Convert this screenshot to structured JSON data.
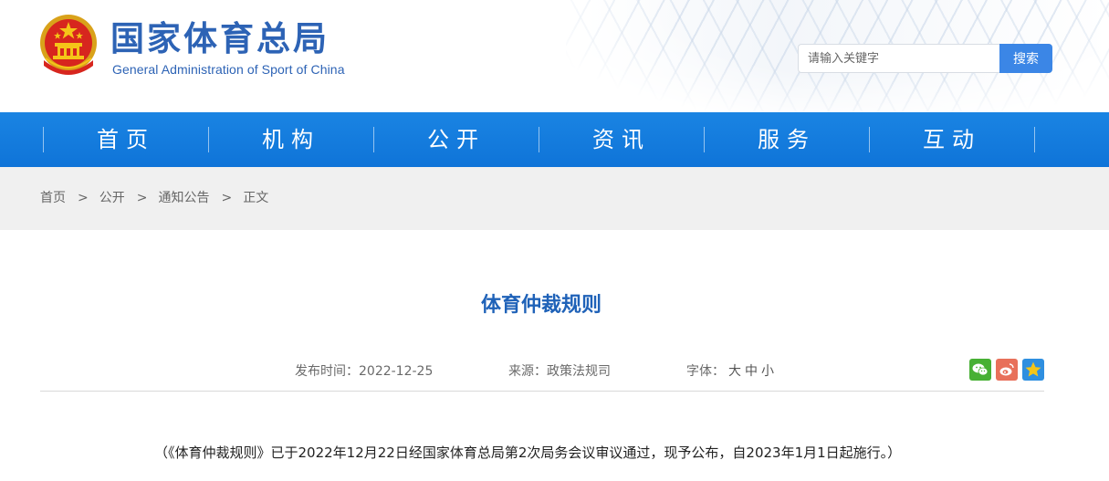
{
  "header": {
    "title_cn": "国家体育总局",
    "title_en": "General Administration of Sport of China",
    "emblem_icon": "national-emblem-icon"
  },
  "search": {
    "placeholder": "请输入关键字",
    "button_label": "搜索"
  },
  "nav": {
    "items": [
      {
        "label": "首页"
      },
      {
        "label": "机构"
      },
      {
        "label": "公开"
      },
      {
        "label": "资讯"
      },
      {
        "label": "服务"
      },
      {
        "label": "互动"
      }
    ]
  },
  "breadcrumb": {
    "items": [
      "首页",
      "公开",
      "通知公告",
      "正文"
    ],
    "separator": ">"
  },
  "article": {
    "title": "体育仲裁规则",
    "date_label": "发布时间：",
    "date": "2022-12-25",
    "source_label": "来源：",
    "source": "政策法规司",
    "font_label": "字体：",
    "font_large": "大",
    "font_medium": "中",
    "font_small": "小",
    "share_icons": [
      "wechat-icon",
      "weibo-icon",
      "favorite-icon"
    ],
    "body_first_line": "（《体育仲裁规则》已于2022年12月22日经国家体育总局第2次局务会议审议通过，现予公布，自2023年1月1日起施行。）"
  },
  "colors": {
    "brand_blue": "#2d63b5",
    "nav_blue": "#1a84e3",
    "title_blue": "#1f62b8",
    "search_button": "#3b86e6",
    "wechat_green": "#47b034",
    "weibo_red": "#e8705a",
    "favorite_blue": "#2f8fe0"
  }
}
